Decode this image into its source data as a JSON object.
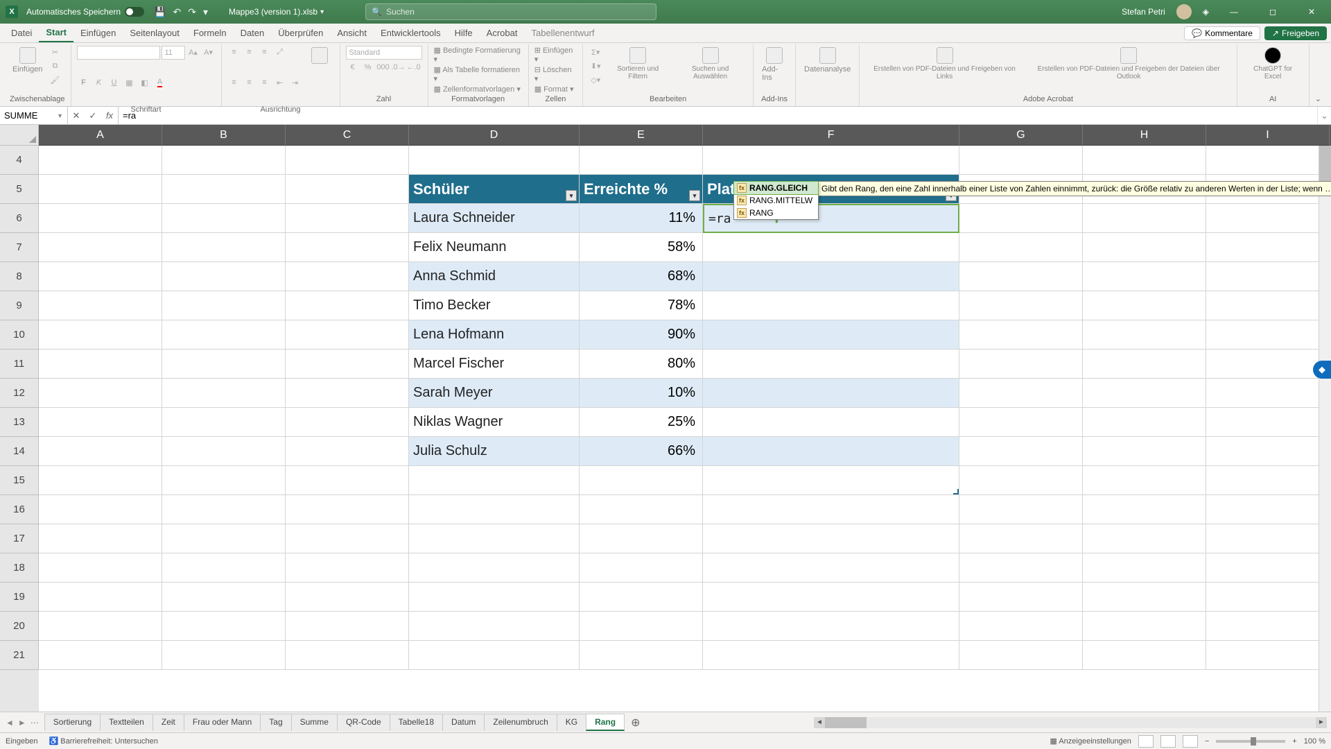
{
  "titlebar": {
    "autosave_label": "Automatisches Speichern",
    "filename": "Mappe3 (version 1).xlsb",
    "search_placeholder": "Suchen",
    "username": "Stefan Petri"
  },
  "ribbon_tabs": [
    "Datei",
    "Start",
    "Einfügen",
    "Seitenlayout",
    "Formeln",
    "Daten",
    "Überprüfen",
    "Ansicht",
    "Entwicklertools",
    "Hilfe",
    "Acrobat",
    "Tabellenentwurf"
  ],
  "ribbon_active_tab": 1,
  "ribbon_right": {
    "comments": "Kommentare",
    "share": "Freigeben"
  },
  "ribbon_groups": {
    "clipboard": {
      "paste": "Einfügen",
      "label": "Zwischenablage"
    },
    "font": {
      "family": "",
      "size": "11",
      "label": "Schriftart"
    },
    "alignment": {
      "label": "Ausrichtung"
    },
    "number": {
      "format": "Standard",
      "label": "Zahl"
    },
    "styles": {
      "cond": "Bedingte Formatierung",
      "astable": "Als Tabelle formatieren",
      "cellstyles": "Zellenformatvorlagen",
      "label": "Formatvorlagen"
    },
    "cells": {
      "insert": "Einfügen",
      "delete": "Löschen",
      "format": "Format",
      "label": "Zellen"
    },
    "editing": {
      "sort": "Sortieren und Filtern",
      "find": "Suchen und Auswählen",
      "label": "Bearbeiten"
    },
    "addins": {
      "addins": "Add-Ins",
      "label": "Add-Ins"
    },
    "analysis": {
      "btn": "Datenanalyse"
    },
    "acrobat": {
      "createshare": "Erstellen von PDF-Dateien und Freigeben von Links",
      "createoutlook": "Erstellen von PDF-Dateien und Freigeben der Dateien über Outlook",
      "label": "Adobe Acrobat"
    },
    "ai": {
      "gpt": "ChatGPT for Excel",
      "label": "AI"
    }
  },
  "namebox": "SUMME",
  "formula": "=ra",
  "columns": [
    "A",
    "B",
    "C",
    "D",
    "E",
    "F",
    "G",
    "H",
    "I"
  ],
  "first_row": 4,
  "num_rows": 18,
  "table": {
    "header_row": 5,
    "columns": [
      "Schüler",
      "Erreichte %",
      "Platzierung"
    ],
    "rows": [
      {
        "schueler": "Laura Schneider",
        "pct": "11%"
      },
      {
        "schueler": "Felix Neumann",
        "pct": "58%"
      },
      {
        "schueler": "Anna Schmid",
        "pct": "68%"
      },
      {
        "schueler": "Timo Becker",
        "pct": "78%"
      },
      {
        "schueler": "Lena Hofmann",
        "pct": "90%"
      },
      {
        "schueler": "Marcel Fischer",
        "pct": "80%"
      },
      {
        "schueler": "Sarah Meyer",
        "pct": "10%"
      },
      {
        "schueler": "Niklas Wagner",
        "pct": "25%"
      },
      {
        "schueler": "Julia Schulz",
        "pct": "66%"
      }
    ]
  },
  "edit_cell": {
    "address": "F6",
    "text": "=ra"
  },
  "autocomplete": {
    "items": [
      "RANG.GLEICH",
      "RANG.MITTELW",
      "RANG"
    ],
    "selected": 0,
    "tooltip": "Gibt den Rang, den eine Zahl innerhalb einer Liste von Zahlen einnimmt, zurück: die Größe relativ zu anderen Werten in der Liste; wenn mehrere W"
  },
  "sheet_tabs": [
    "Sortierung",
    "Textteilen",
    "Zeit",
    "Frau oder Mann",
    "Tag",
    "Summe",
    "QR-Code",
    "Tabelle18",
    "Datum",
    "Zeilenumbruch",
    "KG",
    "Rang"
  ],
  "active_sheet": 11,
  "statusbar": {
    "mode": "Eingeben",
    "access": "Barrierefreiheit: Untersuchen",
    "display": "Anzeigeeinstellungen",
    "zoom": "100 %"
  }
}
